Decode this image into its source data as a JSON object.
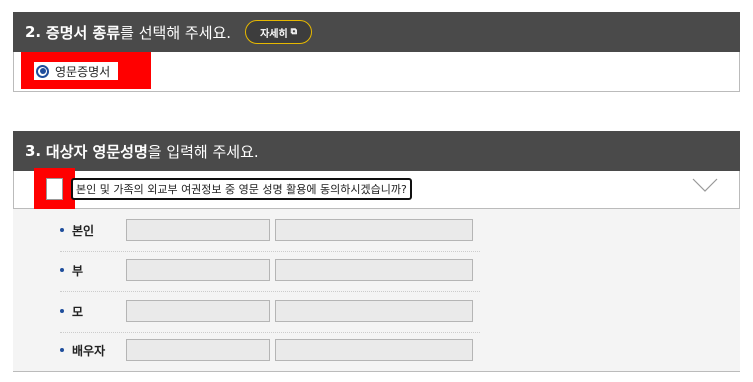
{
  "section2": {
    "number": "2.",
    "title_bold": "증명서 종류",
    "title_rest": "를 선택해 주세요.",
    "detail_button": "자세히",
    "radio_option": "영문증명서"
  },
  "section3": {
    "number": "3.",
    "title_bold": "대상자 영문성명",
    "title_rest": "을 입력해 주세요.",
    "consent_label": "본인 및 가족의 외교부 여권정보 중 영문 성명 활용에 동의하시겠습니까?",
    "rows": [
      {
        "label": "본인"
      },
      {
        "label": "부"
      },
      {
        "label": "모"
      },
      {
        "label": "배우자"
      }
    ]
  },
  "colors": {
    "header_bg": "#4a4a4a",
    "highlight": "#ff0000",
    "accent": "#1f4e9c",
    "button_border": "#e6b800"
  }
}
